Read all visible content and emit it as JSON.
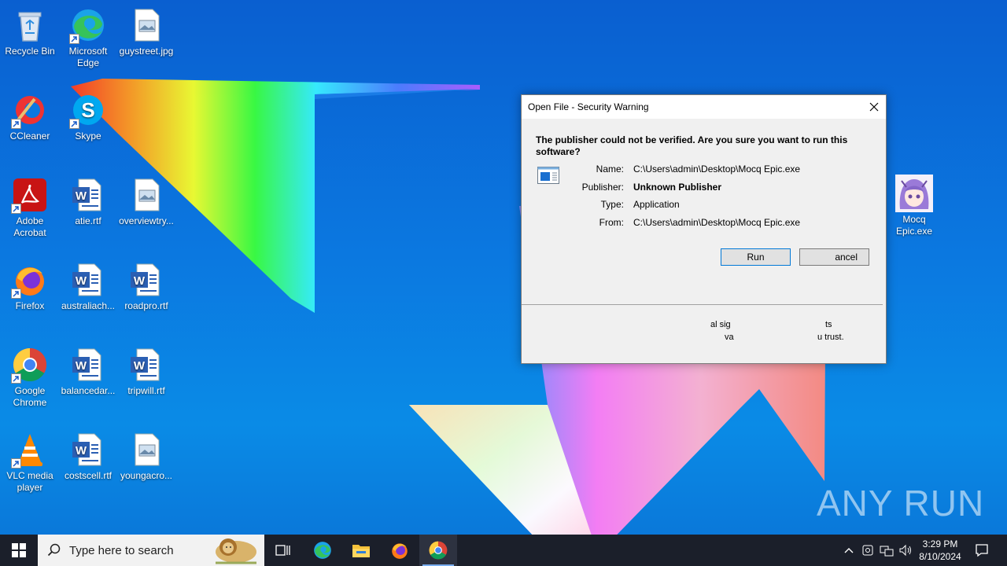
{
  "desktop": {
    "icons": [
      {
        "label": "Recycle Bin",
        "icon": "recycle-bin-icon"
      },
      {
        "label": "Microsoft Edge",
        "icon": "edge-icon"
      },
      {
        "label": "guystreet.jpg",
        "icon": "image-file-icon"
      },
      {
        "label": "CCleaner",
        "icon": "ccleaner-icon"
      },
      {
        "label": "Skype",
        "icon": "skype-icon"
      },
      {
        "label": "Adobe Acrobat",
        "icon": "acrobat-icon"
      },
      {
        "label": "atie.rtf",
        "icon": "word-doc-icon"
      },
      {
        "label": "overviewtry...",
        "icon": "image-file-icon"
      },
      {
        "label": "Firefox",
        "icon": "firefox-icon"
      },
      {
        "label": "australiach...",
        "icon": "word-doc-icon"
      },
      {
        "label": "roadpro.rtf",
        "icon": "word-doc-icon"
      },
      {
        "label": "Google Chrome",
        "icon": "chrome-icon"
      },
      {
        "label": "balancedar...",
        "icon": "word-doc-icon"
      },
      {
        "label": "tripwill.rtf",
        "icon": "word-doc-icon"
      },
      {
        "label": "VLC media player",
        "icon": "vlc-icon"
      },
      {
        "label": "costscell.rtf",
        "icon": "word-doc-icon"
      },
      {
        "label": "youngacro...",
        "icon": "image-file-icon"
      }
    ],
    "selected_file": {
      "label": "Mocq Epic.exe",
      "icon": "anime-avatar-icon"
    }
  },
  "dialog": {
    "title": "Open File - Security Warning",
    "question": "The publisher could not be verified.  Are you sure you want to run this software?",
    "fields": {
      "name_label": "Name:",
      "name_value": "C:\\Users\\admin\\Desktop\\Mocq Epic.exe",
      "publisher_label": "Publisher:",
      "publisher_value": "Unknown Publisher",
      "type_label": "Type:",
      "type_value": "Application",
      "from_label": "From:",
      "from_value": "C:\\Users\\admin\\Desktop\\Mocq Epic.exe"
    },
    "run_label": "Run",
    "cancel_label": "ancel",
    "footer_line1": "al sig",
    "footer_line1b": "ts",
    "footer_line2": "va",
    "footer_line2b": "u trust."
  },
  "watermark": "ANY RUN",
  "taskbar": {
    "search_placeholder": "Type here to search",
    "clock_time": "3:29 PM",
    "clock_date": "8/10/2024"
  },
  "colors": {
    "desktop_blue": "#0b78e0",
    "taskbar": "#1b1f2a",
    "accent": "#0078d7"
  }
}
